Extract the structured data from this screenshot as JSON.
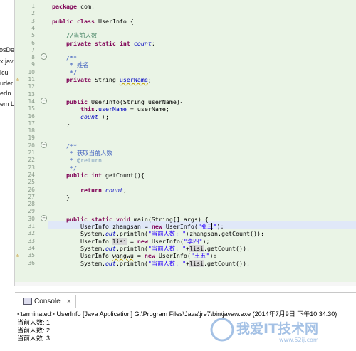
{
  "package_explorer": {
    "items": [
      "osDe",
      "x.jav",
      "lcul",
      "uder",
      "erIn",
      "em L"
    ]
  },
  "editor": {
    "lines": [
      {
        "n": "1"
      },
      {
        "n": "2"
      },
      {
        "n": "3"
      },
      {
        "n": "4"
      },
      {
        "n": "5"
      },
      {
        "n": "6"
      },
      {
        "n": "7"
      },
      {
        "n": "8"
      },
      {
        "n": "9"
      },
      {
        "n": "10"
      },
      {
        "n": "11"
      },
      {
        "n": "12"
      },
      {
        "n": "13"
      },
      {
        "n": "14"
      },
      {
        "n": "15"
      },
      {
        "n": "16"
      },
      {
        "n": "17"
      },
      {
        "n": "18"
      },
      {
        "n": "19"
      },
      {
        "n": "20"
      },
      {
        "n": "21"
      },
      {
        "n": "22"
      },
      {
        "n": "23"
      },
      {
        "n": "24"
      },
      {
        "n": "25"
      },
      {
        "n": "26"
      },
      {
        "n": "27"
      },
      {
        "n": "28"
      },
      {
        "n": "29"
      },
      {
        "n": "30"
      },
      {
        "n": "31"
      },
      {
        "n": "32"
      },
      {
        "n": "33"
      },
      {
        "n": "34"
      },
      {
        "n": "35"
      },
      {
        "n": "36"
      }
    ],
    "code": {
      "l1": [
        "package",
        " com;"
      ],
      "l3": [
        "public",
        " ",
        "class",
        " UserInfo {"
      ],
      "l5": "//当前人数",
      "l6": [
        "private",
        " ",
        "static",
        " ",
        "int",
        " ",
        "count",
        ";"
      ],
      "l8": "/**",
      "l9": " * 姓名",
      "l10": " */",
      "l11": [
        "private",
        " String ",
        "userName",
        ";"
      ],
      "l14": [
        "public",
        " UserInfo(String ",
        "userName",
        "){"
      ],
      "l15": [
        "this",
        ".",
        "userName",
        " = ",
        "userName",
        ";"
      ],
      "l16": [
        "count",
        "++;"
      ],
      "l17": "}",
      "l20": "/**",
      "l21": " * 获取当前人数",
      "l22": [
        " * ",
        "@return"
      ],
      "l23": " */",
      "l24": [
        "public",
        " ",
        "int",
        " getCount(){"
      ],
      "l26": [
        "return",
        " ",
        "count",
        ";"
      ],
      "l27": "}",
      "l30": [
        "public",
        " ",
        "static",
        " ",
        "void",
        " main(String[] args) {"
      ],
      "l31": [
        "UserInfo ",
        "zhangsan",
        " = ",
        "new",
        " UserInfo(",
        "\"张三\"",
        ");"
      ],
      "l32": [
        "System.",
        "out",
        ".println(",
        "\"当前人数: \"",
        "+zhangsan.getCount());"
      ],
      "l33": [
        "UserInfo ",
        "lisi",
        " = ",
        "new",
        " UserInfo(",
        "\"李四\"",
        ");"
      ],
      "l34": [
        "System.",
        "out",
        ".println(",
        "\"当前人数: \"",
        "+",
        "lisi",
        ".getCount());"
      ],
      "l35": [
        "UserInfo ",
        "wangwu",
        " = ",
        "new",
        " UserInfo(",
        "\"王五\"",
        ");"
      ],
      "l36": [
        "System.",
        "out",
        ".println(",
        "\"当前人数: \"",
        "+",
        "lisi",
        ".getCount());"
      ]
    }
  },
  "console": {
    "tab_label": "Console",
    "tab_close": "✕",
    "terminated": "<terminated> UserInfo [Java Application] G:\\Program Files\\Java\\jre7\\bin\\javaw.exe (2014年7月9日 下午10:34:30)",
    "output": [
      "当前人数: 1",
      "当前人数: 2",
      "当前人数: 3"
    ]
  },
  "watermark": {
    "text": "我爱IT技术网",
    "url": "www.52ij.com"
  }
}
